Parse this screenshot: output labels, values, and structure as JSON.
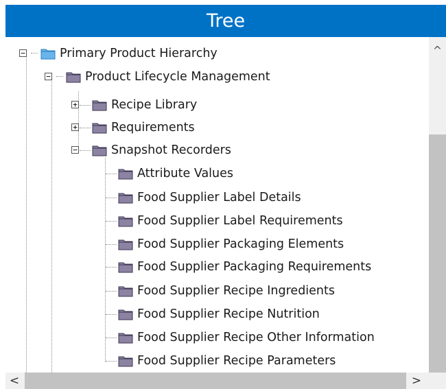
{
  "header": {
    "title": "Tree"
  },
  "colors": {
    "header_bg": "#0072c6",
    "root_folder": "#6ab4ec",
    "folder": "#8c83a3",
    "scrollbar_track": "#f0f0f0",
    "scrollbar_thumb": "#c2c2c2"
  },
  "tree": {
    "nodes": [
      {
        "label": "Primary Product Hierarchy",
        "level": 0,
        "toggle": "−",
        "icon": "folder-open-blue-icon"
      },
      {
        "label": "Product Lifecycle Management",
        "level": 1,
        "toggle": "−",
        "icon": "folder-icon"
      },
      {
        "label": "Recipe Library",
        "level": 2,
        "toggle": "+",
        "icon": "folder-icon"
      },
      {
        "label": "Requirements",
        "level": 2,
        "toggle": "+",
        "icon": "folder-icon"
      },
      {
        "label": "Snapshot Recorders",
        "level": 2,
        "toggle": "−",
        "icon": "folder-icon"
      },
      {
        "label": "Attribute Values",
        "level": 3,
        "icon": "folder-icon"
      },
      {
        "label": "Food Supplier Label Details",
        "level": 3,
        "icon": "folder-icon"
      },
      {
        "label": "Food Supplier Label Requirements",
        "level": 3,
        "icon": "folder-icon"
      },
      {
        "label": "Food Supplier Packaging Elements",
        "level": 3,
        "icon": "folder-icon"
      },
      {
        "label": "Food Supplier Packaging Requirements",
        "level": 3,
        "icon": "folder-icon"
      },
      {
        "label": "Food Supplier Recipe Ingredients",
        "level": 3,
        "icon": "folder-icon"
      },
      {
        "label": "Food Supplier Recipe Nutrition",
        "level": 3,
        "icon": "folder-icon"
      },
      {
        "label": "Food Supplier Recipe Other Information",
        "level": 3,
        "icon": "folder-icon"
      },
      {
        "label": "Food Supplier Recipe Parameters",
        "level": 3,
        "icon": "folder-icon"
      }
    ]
  },
  "scrollbars": {
    "vertical_up_icon": "^",
    "horizontal_left_icon": "<",
    "horizontal_right_icon": ">"
  }
}
